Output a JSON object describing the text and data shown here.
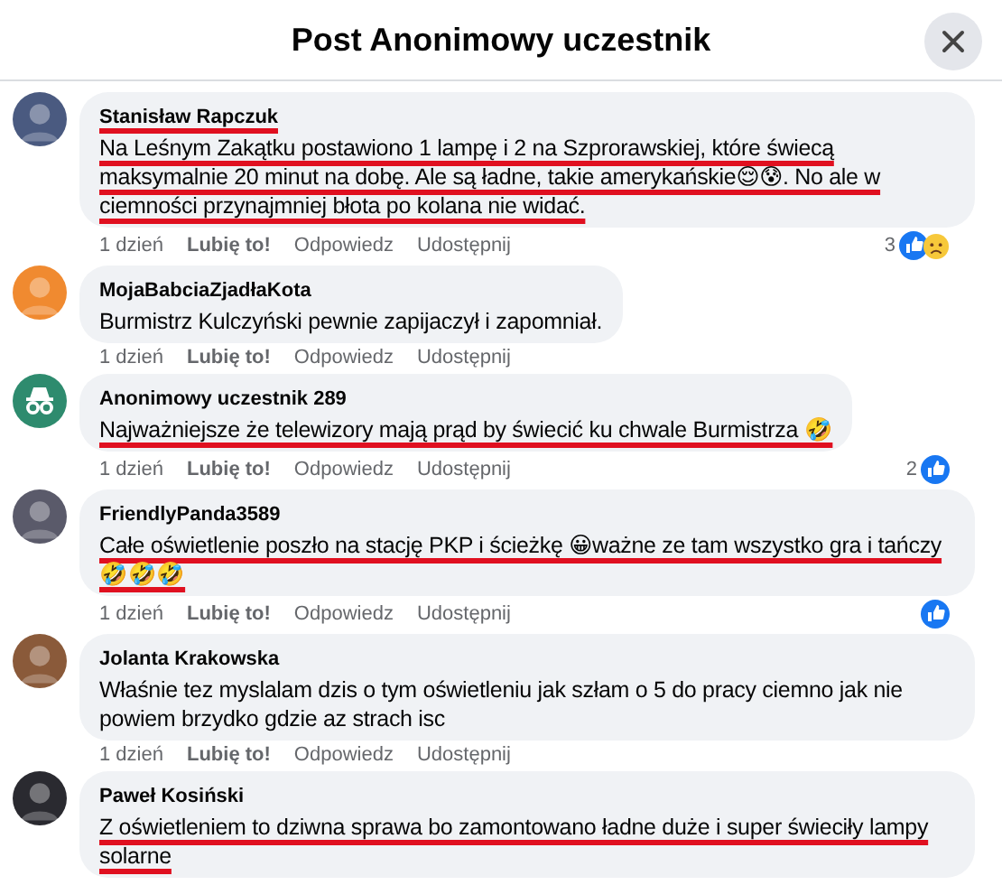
{
  "title": "Post Anonimowy uczestnik",
  "comments": [
    {
      "author": "Stanisław Rapczuk",
      "kind": "photo",
      "color": "#4a5a80",
      "underline_name": true,
      "underline_text": true,
      "text": "Na Leśnym Zakątku postawiono 1 lampę i 2 na Szprorawskiej, które świecą maksymalnie 20 minut na dobę. Ale są ładne, takie amerykańskie😌😰. No ale w ciemności przynajmniej błota po kolana nie widać.",
      "time": "1 dzień",
      "actions": [
        "Lubię to!",
        "Odpowiedz",
        "Udostępnij"
      ],
      "reactions": {
        "count": "3",
        "sad": true
      }
    },
    {
      "author": "MojaBabciaZjadłaKota",
      "kind": "photo",
      "color": "#f08a30",
      "underline_name": false,
      "underline_text": false,
      "text": "Burmistrz Kulczyński pewnie zapijaczył i zapomniał.",
      "time": "1 dzień",
      "actions": [
        "Lubię to!",
        "Odpowiedz",
        "Udostępnij"
      ]
    },
    {
      "author": "Anonimowy uczestnik 289",
      "kind": "anonymous",
      "color": "#2e8b6e",
      "underline_name": false,
      "underline_text": true,
      "text": "Najważniejsze że telewizory mają prąd by świecić ku chwale Burmistrza 🤣",
      "time": "1 dzień",
      "actions": [
        "Lubię to!",
        "Odpowiedz",
        "Udostępnij"
      ],
      "reactions": {
        "count": "2",
        "sad": false
      }
    },
    {
      "author": "FriendlyPanda3589",
      "kind": "photo",
      "color": "#5a5a6a",
      "underline_name": false,
      "underline_text": true,
      "text": "Całe oświetlenie poszło na stację PKP i ścieżkę 😀ważne ze tam wszystko gra i tańczy 🤣🤣🤣",
      "time": "1 dzień",
      "actions": [
        "Lubię to!",
        "Odpowiedz",
        "Udostępnij"
      ],
      "reactions": {
        "sad": false
      }
    },
    {
      "author": "Jolanta Krakowska",
      "kind": "photo",
      "color": "#8a5a3a",
      "underline_name": false,
      "underline_text": false,
      "text": "Właśnie tez myslalam dzis o tym oświetleniu jak szłam o 5 do pracy ciemno jak nie powiem brzydko gdzie az strach isc",
      "time": "1 dzień",
      "actions": [
        "Lubię to!",
        "Odpowiedz",
        "Udostępnij"
      ]
    },
    {
      "author": "Paweł Kosiński",
      "kind": "photo",
      "color": "#2a2a30",
      "underline_name": false,
      "underline_text": true,
      "text": "Z oświetleniem to dziwna sprawa bo zamontowano ładne duże i super świeciły lampy solarne"
    }
  ]
}
